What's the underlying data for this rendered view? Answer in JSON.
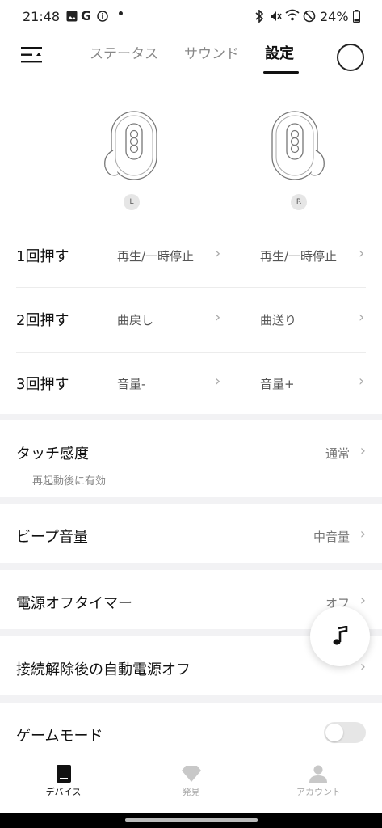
{
  "status_bar": {
    "time": "21:48",
    "battery": "24%"
  },
  "tabs": [
    {
      "label": "ステータス"
    },
    {
      "label": "サウンド"
    },
    {
      "label": "設定"
    }
  ],
  "earbuds": {
    "left_label": "L",
    "right_label": "R"
  },
  "controls": [
    {
      "label": "1回押す",
      "left": "再生/一時停止",
      "right": "再生/一時停止"
    },
    {
      "label": "2回押す",
      "left": "曲戻し",
      "right": "曲送り"
    },
    {
      "label": "3回押す",
      "left": "音量-",
      "right": "音量+"
    }
  ],
  "settings": {
    "touch": {
      "title": "タッチ感度",
      "value": "通常",
      "note": "再起動後に有効"
    },
    "beep": {
      "title": "ビープ音量",
      "value": "中音量"
    },
    "timer": {
      "title": "電源オフタイマー",
      "value": "オフ"
    },
    "auto_off": {
      "title": "接続解除後の自動電源オフ"
    },
    "game": {
      "title": "ゲームモード",
      "enabled": false
    }
  },
  "bottom_nav": [
    {
      "label": "デバイス"
    },
    {
      "label": "発見"
    },
    {
      "label": "アカウント"
    }
  ],
  "colors": {
    "accent": "#111111",
    "inactive": "#999999",
    "background": "#f2f2f4"
  }
}
